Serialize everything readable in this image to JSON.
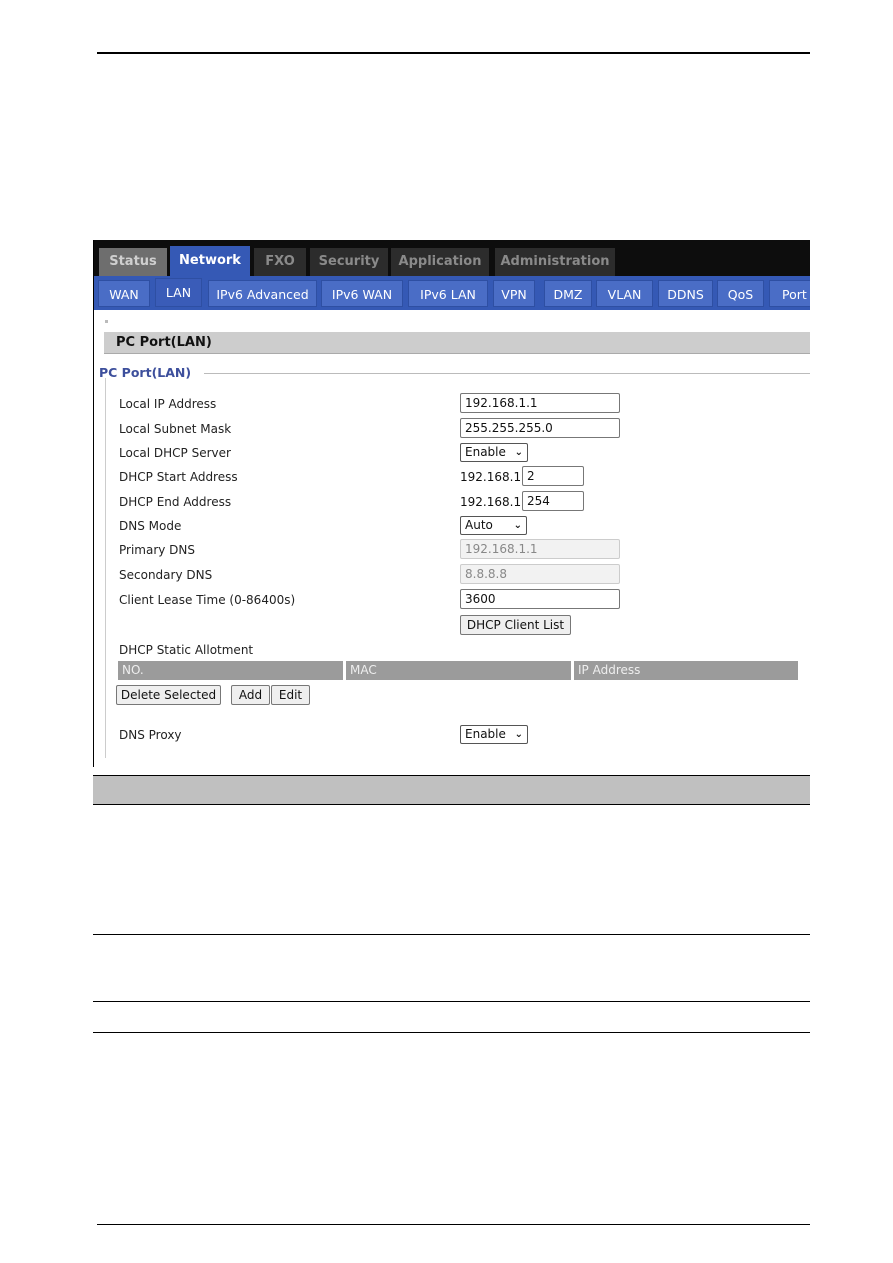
{
  "main_tabs": [
    {
      "label": "Status",
      "active": false
    },
    {
      "label": "Network",
      "active": true
    },
    {
      "label": "FXO",
      "active": false
    },
    {
      "label": "Security",
      "active": false
    },
    {
      "label": "Application",
      "active": false
    },
    {
      "label": "Administration",
      "active": false
    }
  ],
  "sub_tabs": [
    {
      "label": "WAN",
      "active": false
    },
    {
      "label": "LAN",
      "active": true
    },
    {
      "label": "IPv6 Advanced",
      "active": false
    },
    {
      "label": "IPv6 WAN",
      "active": false
    },
    {
      "label": "IPv6 LAN",
      "active": false
    },
    {
      "label": "VPN",
      "active": false
    },
    {
      "label": "DMZ",
      "active": false
    },
    {
      "label": "VLAN",
      "active": false
    },
    {
      "label": "DDNS",
      "active": false
    },
    {
      "label": "QoS",
      "active": false
    },
    {
      "label": "Port",
      "active": false
    }
  ],
  "section": {
    "header": "PC Port(LAN)",
    "legend": "PC Port(LAN)"
  },
  "form": {
    "local_ip": {
      "label": "Local IP Address",
      "value": "192.168.1.1"
    },
    "subnet_mask": {
      "label": "Local Subnet Mask",
      "value": "255.255.255.0"
    },
    "dhcp_server": {
      "label": "Local DHCP Server",
      "value": "Enable"
    },
    "dhcp_start": {
      "label": "DHCP Start Address",
      "prefix": "192.168.1.",
      "value": "2"
    },
    "dhcp_end": {
      "label": "DHCP End Address",
      "prefix": "192.168.1.",
      "value": "254"
    },
    "dns_mode": {
      "label": "DNS Mode",
      "value": "Auto"
    },
    "primary_dns": {
      "label": "Primary DNS",
      "value": "192.168.1.1"
    },
    "secondary_dns": {
      "label": "Secondary DNS",
      "value": "8.8.8.8"
    },
    "lease_time": {
      "label": "Client Lease Time (0-86400s)",
      "value": "3600"
    },
    "dhcp_client_list_button": "DHCP Client List",
    "static_allotment": {
      "label": "DHCP Static Allotment",
      "columns": [
        "NO.",
        "MAC",
        "IP Address"
      ]
    },
    "buttons": {
      "delete_selected": "Delete Selected",
      "add": "Add",
      "edit": "Edit"
    },
    "dns_proxy": {
      "label": "DNS Proxy",
      "value": "Enable"
    }
  },
  "icons": {
    "chevron": "⌄"
  }
}
